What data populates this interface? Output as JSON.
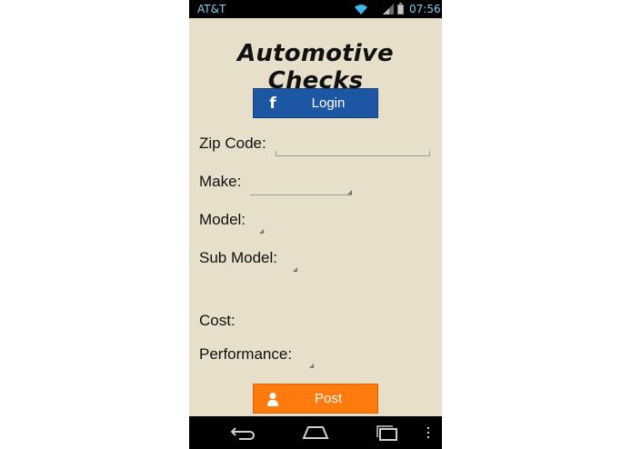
{
  "status_bar": {
    "carrier": "AT&T",
    "time": "07:56",
    "icons": [
      "wifi-icon",
      "signal-icon",
      "battery-icon"
    ]
  },
  "app": {
    "title": "Automotive Checks"
  },
  "login_button": {
    "label": "Login",
    "icon": "facebook-icon",
    "color": "#1d57a3"
  },
  "form": {
    "zip_code": {
      "label": "Zip Code:",
      "value": "",
      "placeholder": ""
    },
    "make": {
      "label": "Make:",
      "selected": ""
    },
    "model": {
      "label": "Model:",
      "selected": ""
    },
    "sub_model": {
      "label": "Sub Model:",
      "selected": ""
    },
    "cost": {
      "label": "Cost:"
    },
    "performance": {
      "label": "Performance:",
      "selected": ""
    }
  },
  "post_button": {
    "label": "Post",
    "icon": "person-icon",
    "color": "#ff7a0c"
  },
  "nav_bar": {
    "icons": [
      "back-icon",
      "home-icon",
      "recent-apps-icon",
      "menu-icon"
    ]
  },
  "colors": {
    "background": "#e7dfca",
    "status_text": "#7fd0f0",
    "text": "#111111"
  }
}
